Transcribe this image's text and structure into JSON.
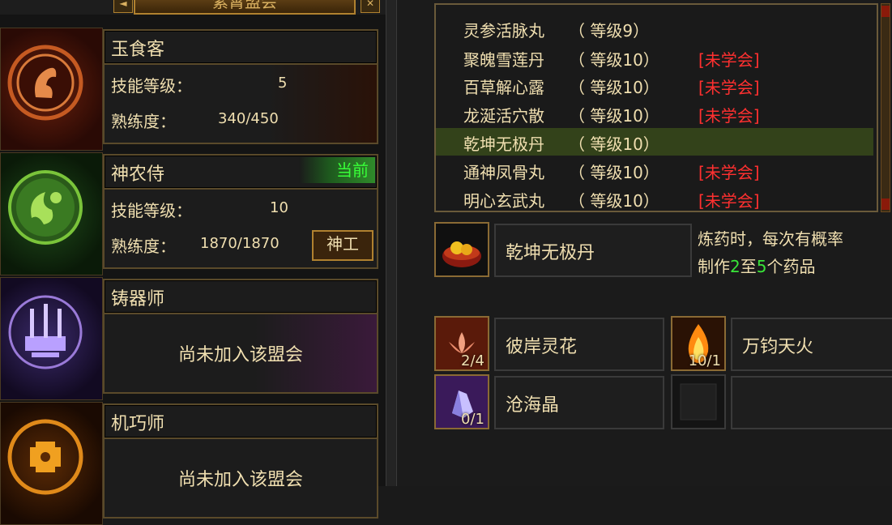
{
  "header": {
    "title": "紫霄盟会",
    "left_btn": "◄",
    "right_btn": "✕"
  },
  "guild_cards": [
    {
      "name": "玉食客",
      "skill_level_label": "技能等级：",
      "skill_level": "5",
      "proficiency_label": "熟练度：",
      "proficiency": "340/450",
      "emblem_color": "#b54a1c",
      "bg": "#5a1a0a"
    },
    {
      "name": "神农侍",
      "current_badge": "当前",
      "skill_level_label": "技能等级：",
      "skill_level": "10",
      "proficiency_label": "熟练度：",
      "proficiency": "1870/1870",
      "action_button": "神工",
      "emblem_color": "#7ac43a",
      "bg": "#153a12"
    },
    {
      "name": "铸器师",
      "status": "尚未加入该盟会",
      "emblem_color": "#9a7ad8",
      "bg": "#2a1a4a"
    },
    {
      "name": "机巧师",
      "status": "尚未加入该盟会",
      "emblem_color": "#e08a1a",
      "bg": "#4a2a05"
    }
  ],
  "recipe_list": [
    {
      "name": "灵参活脉丸",
      "level": "（ 等级9）",
      "status": ""
    },
    {
      "name": "聚魄雪莲丹",
      "level": "（ 等级10）",
      "status": "[未学会]"
    },
    {
      "name": "百草解心露",
      "level": "（ 等级10）",
      "status": "[未学会]"
    },
    {
      "name": "龙涎活穴散",
      "level": "（ 等级10）",
      "status": "[未学会]"
    },
    {
      "name": "乾坤无极丹",
      "level": "（ 等级10）",
      "status": ""
    },
    {
      "name": "通神凤骨丸",
      "level": "（ 等级10）",
      "status": "[未学会]"
    },
    {
      "name": "明心玄武丸",
      "level": "（ 等级10）",
      "status": "[未学会]"
    }
  ],
  "selected_recipe": {
    "name": "乾坤无极丹",
    "desc_line1": "炼药时，每次有概率",
    "desc_prefix": "制作",
    "desc_min": "2",
    "desc_mid": "至",
    "desc_max": "5",
    "desc_suffix": "个药品"
  },
  "materials": [
    {
      "name": "彼岸灵花",
      "count": "2/4",
      "icon": "lotus-flower-icon"
    },
    {
      "name": "万钧天火",
      "count": "10/1",
      "icon": "flame-icon"
    },
    {
      "name": "沧海晶",
      "count": "0/1",
      "icon": "crystal-icon"
    }
  ],
  "colors": {
    "accent_gold": "#b0812f",
    "text_cream": "#f0dfb0",
    "unlearned_red": "#ff3030",
    "current_green": "#38ff38",
    "selected_row": "#33421a"
  }
}
